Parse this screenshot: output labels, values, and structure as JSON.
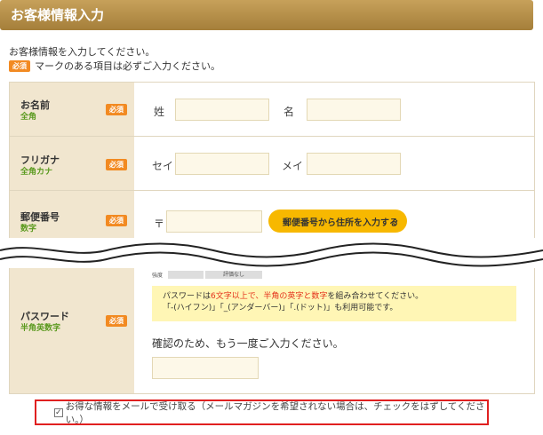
{
  "header": {
    "title": "お客様情報入力"
  },
  "intro": {
    "line1": "お客様情報を入力してください。",
    "required_badge": "必須",
    "line2": "マークのある項目は必ずご入力ください。"
  },
  "rows": {
    "name": {
      "label": "お名前",
      "sub": "全角",
      "badge": "必須",
      "first_label": "姓",
      "first_value": "",
      "last_label": "名",
      "last_value": ""
    },
    "kana": {
      "label": "フリガナ",
      "sub": "全角カナ",
      "badge": "必須",
      "first_label": "セイ",
      "first_value": "",
      "last_label": "メイ",
      "last_value": ""
    },
    "zip": {
      "label": "郵便番号",
      "sub": "数字",
      "badge": "必須",
      "mark": "〒",
      "value": "",
      "button_label": "郵便番号から住所を入力する",
      "button_chevron": "›"
    },
    "password": {
      "label": "パスワード",
      "sub": "半角英数字",
      "badge": "必須",
      "strength_label": "強度",
      "strength_value": "評価なし",
      "note_a": "パスワードは",
      "note_b": "6文字以上で、半角の英字と数字",
      "note_c": "を組み合わせてください。",
      "note_line2": "「-(ハイフン)」「_(アンダーバー)」「.(ドット)」も利用可能です。",
      "confirm_text": "確認のため、もう一度ご入力ください。",
      "confirm_value": ""
    }
  },
  "newsletter": {
    "checked": true,
    "check_mark": "✓",
    "label": "お得な情報をメールで受け取る（メールマガジンを希望されない場合は、チェックをはずしてください。）"
  },
  "colors": {
    "header": "#b08a45",
    "badge": "#f28a22",
    "label_bg": "#f1e6cf",
    "sub_label": "#5b9a1f",
    "input_bg": "#fdf8e8",
    "button": "#f7b800",
    "note_bg": "#fff6b5",
    "note_red": "#e4321b",
    "highlight_border": "#e02020"
  }
}
